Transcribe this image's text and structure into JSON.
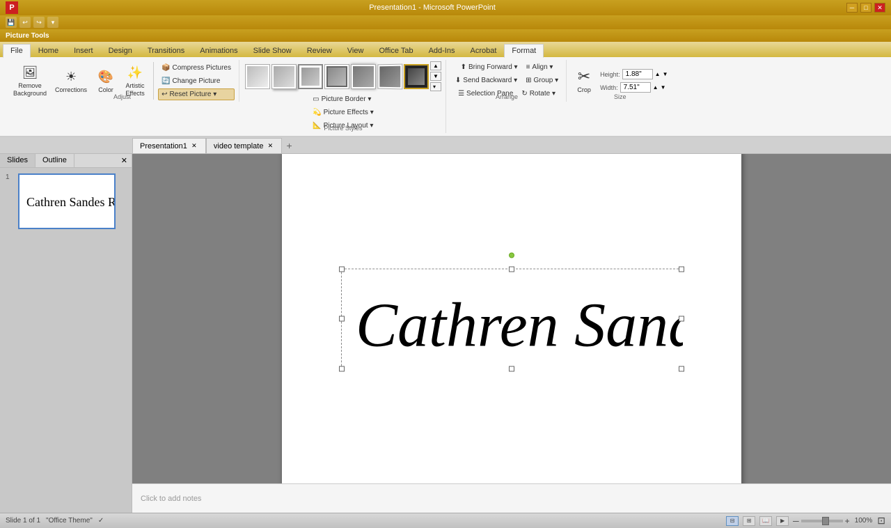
{
  "titlebar": {
    "title": "Presentation1 - Microsoft PowerPoint",
    "context_tool": "Picture Tools",
    "format_tab": "Format",
    "buttons": [
      "minimize",
      "restore",
      "close"
    ]
  },
  "quickaccess": {
    "buttons": [
      "save",
      "undo",
      "redo",
      "customize"
    ]
  },
  "ribbon": {
    "context_label": "Picture Tools",
    "tabs": [
      "File",
      "Home",
      "Insert",
      "Design",
      "Transitions",
      "Animations",
      "Slide Show",
      "Review",
      "View",
      "Office Tab",
      "Add-Ins",
      "Acrobat",
      "Format"
    ],
    "active_tab": "Format",
    "groups": {
      "adjust": {
        "label": "Adjust",
        "buttons": [
          {
            "id": "remove-bg",
            "label": "Remove\nBackground",
            "icon": "🖼️"
          },
          {
            "id": "corrections",
            "label": "Corrections",
            "icon": "☀️"
          },
          {
            "id": "color",
            "label": "Color",
            "icon": "🎨"
          },
          {
            "id": "artistic-effects",
            "label": "Artistic\nEffects",
            "icon": "✨"
          }
        ],
        "small_buttons": [
          {
            "id": "compress-pictures",
            "label": "Compress Pictures",
            "icon": "📦"
          },
          {
            "id": "change-picture",
            "label": "Change Picture",
            "icon": "🔄"
          },
          {
            "id": "reset-picture",
            "label": "Reset Picture",
            "icon": "↩"
          }
        ]
      },
      "picture_styles": {
        "label": "Picture Styles",
        "thumbs": [
          {
            "id": "s1",
            "type": "none"
          },
          {
            "id": "s2",
            "type": "shadow"
          },
          {
            "id": "s3",
            "type": "reflection"
          },
          {
            "id": "s4",
            "type": "frame"
          },
          {
            "id": "s5",
            "type": "soft"
          },
          {
            "id": "s6",
            "type": "perspective"
          },
          {
            "id": "s7",
            "type": "dark-frame",
            "active": true
          }
        ],
        "small_buttons": [
          {
            "id": "picture-border",
            "label": "Picture Border",
            "icon": "▭"
          },
          {
            "id": "picture-effects",
            "label": "Picture Effects",
            "icon": "💫"
          },
          {
            "id": "picture-layout",
            "label": "Picture Layout",
            "icon": "📐"
          }
        ]
      },
      "arrange": {
        "label": "Arrange",
        "buttons": [
          {
            "id": "bring-forward",
            "label": "Bring Forward",
            "icon": "⬆"
          },
          {
            "id": "send-backward",
            "label": "Send Backward",
            "icon": "⬇"
          },
          {
            "id": "selection-pane",
            "label": "Selection Pane",
            "icon": "☰"
          },
          {
            "id": "align",
            "label": "Align",
            "icon": "≡"
          },
          {
            "id": "group",
            "label": "Group",
            "icon": "⊞"
          },
          {
            "id": "rotate",
            "label": "Rotate",
            "icon": "↻"
          }
        ]
      },
      "crop": {
        "label": "Size",
        "buttons": [
          {
            "id": "crop",
            "label": "Crop",
            "icon": "✂"
          }
        ],
        "height": {
          "label": "Height:",
          "value": "1.88\""
        },
        "width": {
          "label": "Width:",
          "value": "7.51\""
        }
      }
    }
  },
  "doc_tabs": [
    {
      "label": "Presentation1",
      "active": true,
      "closable": true
    },
    {
      "label": "video template",
      "active": false,
      "closable": true
    }
  ],
  "panel": {
    "tabs": [
      "Slides",
      "Outline"
    ],
    "active_tab": "Slides",
    "slides": [
      {
        "number": 1,
        "content": "Cathren Sandes Road"
      }
    ]
  },
  "slide": {
    "content": "Cathren Sandles Road",
    "notes_placeholder": "Click to add notes"
  },
  "statusbar": {
    "slide_info": "Slide 1 of 1",
    "theme": "\"Office Theme\"",
    "zoom": "100%",
    "views": [
      "normal",
      "slide-sorter",
      "reading-view",
      "slideshow"
    ]
  }
}
